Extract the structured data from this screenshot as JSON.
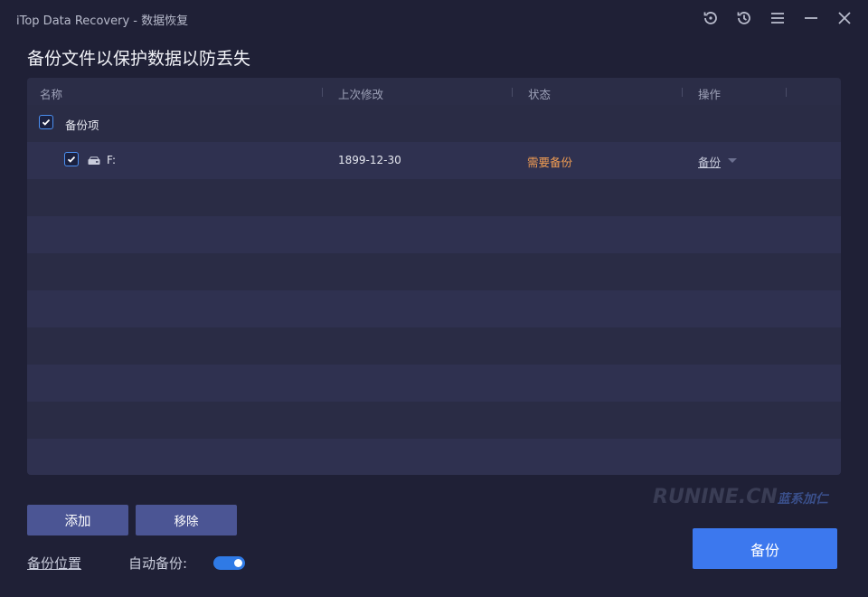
{
  "window": {
    "title": "iTop Data Recovery - 数据恢复"
  },
  "page": {
    "title": "备份文件以保护数据以防丢失"
  },
  "table": {
    "columns": [
      "名称",
      "上次修改",
      "状态",
      "操作"
    ],
    "group": {
      "label": "备份项",
      "checked": true
    },
    "rows": [
      {
        "name": "F:",
        "modified": "1899-12-30",
        "status": "需要备份",
        "action": "备份",
        "checked": true,
        "icon": "drive-icon"
      }
    ]
  },
  "buttons": {
    "add": "添加",
    "remove": "移除",
    "backup": "备份"
  },
  "footer": {
    "backup_location": "备份位置",
    "auto_backup_label": "自动备份:",
    "auto_backup_enabled": true
  },
  "watermark": {
    "text": "RUNINE.CN",
    "sub": "蓝系加仁"
  },
  "colors": {
    "background": "#1f2036",
    "table_bg": "#2a2c45",
    "row_alt": "#2f3150",
    "accent": "#3c78ee",
    "status_warning": "#ef9c53",
    "secondary_button": "#4b5594"
  }
}
